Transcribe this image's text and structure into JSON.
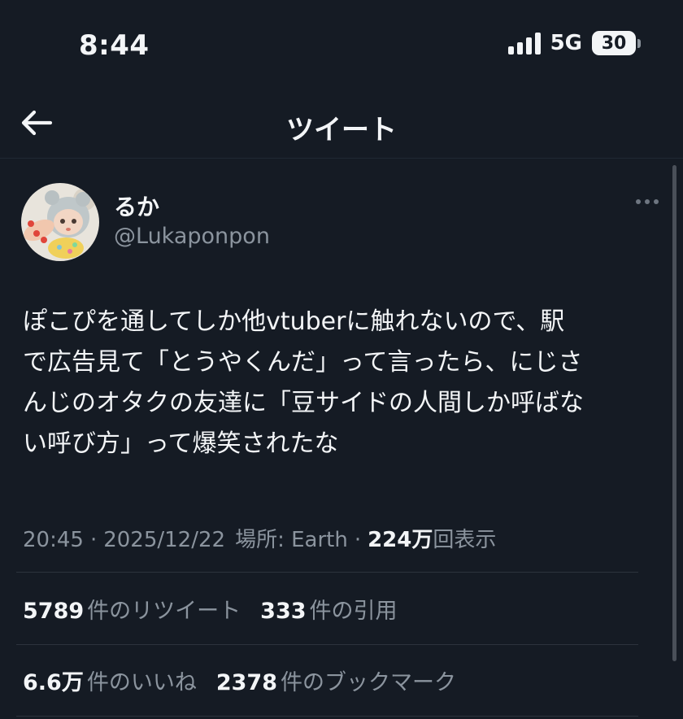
{
  "status_bar": {
    "time": "8:44",
    "network": "5G",
    "battery": "30"
  },
  "nav": {
    "back_icon": "arrow-left-icon",
    "title": "ツイート"
  },
  "tweet": {
    "author": {
      "display_name": "るか",
      "handle": "@Lukaponpon"
    },
    "more_icon": "more-horizontal-icon",
    "text": "ぽこぴを通してしか他vtuberに触れないので、駅\nで広告見て「とうやくんだ」って言ったら、にじさ\nんじのオタクの友達に「豆サイドの人間しか呼ばな\nい呼び方」って爆笑されたな",
    "meta": {
      "time": "20:45",
      "date": "2025/12/22",
      "location_label": "場所: Earth",
      "views_count": "224万",
      "views_label": "回表示"
    },
    "stats": {
      "retweets_count": "5789",
      "retweets_label": "件のリツイート",
      "quotes_count": "333",
      "quotes_label": "件の引用",
      "likes_count": "6.6万",
      "likes_label": "件のいいね",
      "bookmarks_count": "2378",
      "bookmarks_label": "件のブックマーク"
    }
  },
  "colors": {
    "background": "#151b24",
    "text_primary": "#f3f5f7",
    "text_secondary": "#8b949e",
    "divider": "#2c333d"
  }
}
